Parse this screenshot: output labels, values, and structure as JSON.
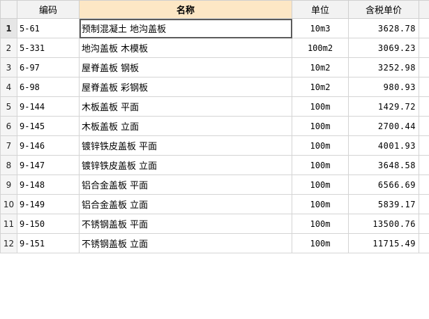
{
  "table": {
    "columns": {
      "code": "编码",
      "name": "名称",
      "unit": "单位",
      "price": "含税单价"
    },
    "rows": [
      {
        "num": "1",
        "code": "5-61",
        "name": "预制混凝土 地沟盖板",
        "unit": "10m3",
        "price": "3628.78"
      },
      {
        "num": "2",
        "code": "5-331",
        "name": "地沟盖板 木模板",
        "unit": "100m2",
        "price": "3069.23"
      },
      {
        "num": "3",
        "code": "6-97",
        "name": "屋脊盖板 钢板",
        "unit": "10m2",
        "price": "3252.98"
      },
      {
        "num": "4",
        "code": "6-98",
        "name": "屋脊盖板 彩钢板",
        "unit": "10m2",
        "price": "980.93"
      },
      {
        "num": "5",
        "code": "9-144",
        "name": "木板盖板 平面",
        "unit": "100m",
        "price": "1429.72"
      },
      {
        "num": "6",
        "code": "9-145",
        "name": "木板盖板 立面",
        "unit": "100m",
        "price": "2700.44"
      },
      {
        "num": "7",
        "code": "9-146",
        "name": "镀锌铁皮盖板 平面",
        "unit": "100m",
        "price": "4001.93"
      },
      {
        "num": "8",
        "code": "9-147",
        "name": "镀锌铁皮盖板 立面",
        "unit": "100m",
        "price": "3648.58"
      },
      {
        "num": "9",
        "code": "9-148",
        "name": "铝合金盖板 平面",
        "unit": "100m",
        "price": "6566.69"
      },
      {
        "num": "10",
        "code": "9-149",
        "name": "铝合金盖板 立面",
        "unit": "100m",
        "price": "5839.17"
      },
      {
        "num": "11",
        "code": "9-150",
        "name": "不锈钢盖板 平面",
        "unit": "100m",
        "price": "13500.76"
      },
      {
        "num": "12",
        "code": "9-151",
        "name": "不锈钢盖板 立面",
        "unit": "100m",
        "price": "11715.49"
      }
    ]
  }
}
